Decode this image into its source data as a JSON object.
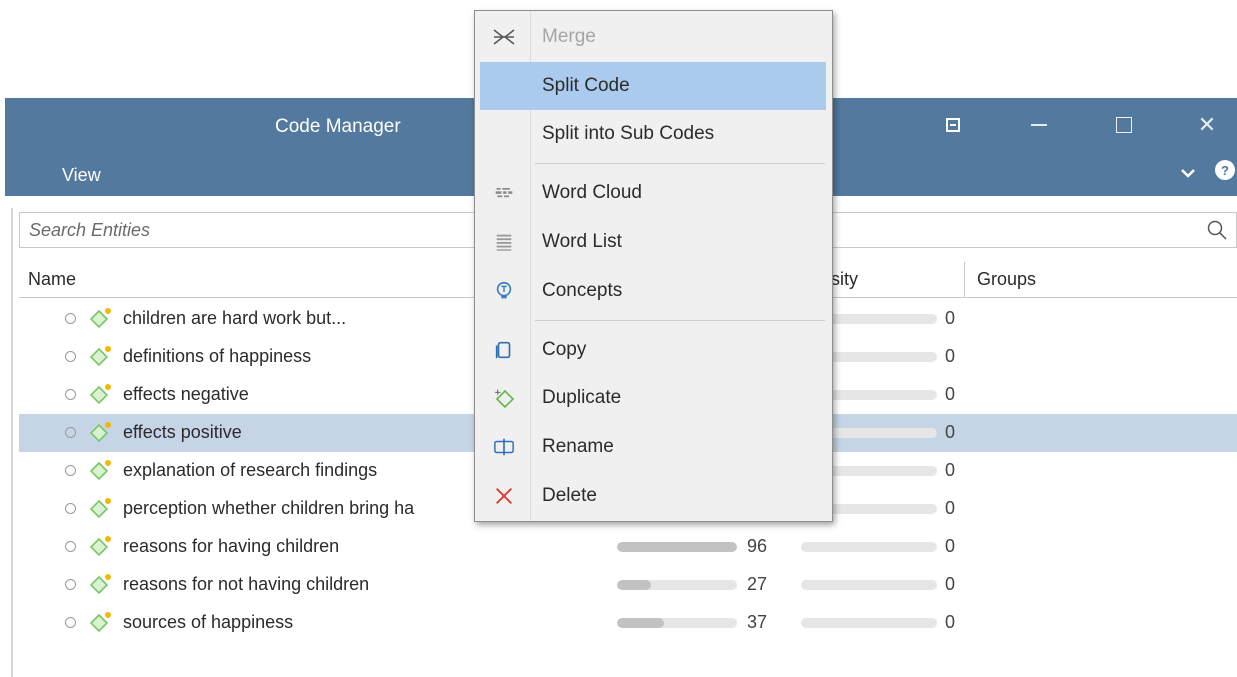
{
  "window": {
    "title": "Code Manager",
    "menu_view": "View",
    "close_glyph": "✕",
    "chevron_glyph": "⌄",
    "help_glyph": "?"
  },
  "search": {
    "placeholder": "Search Entities"
  },
  "columns": {
    "name": "Name",
    "density_partial": "sity",
    "groups": "Groups"
  },
  "codes": [
    {
      "label": "children are hard work but...",
      "count": "",
      "density": "0"
    },
    {
      "label": "definitions of happiness",
      "count": "",
      "density": "0"
    },
    {
      "label": "effects negative",
      "count": "",
      "density": "0"
    },
    {
      "label": "effects positive",
      "count": "",
      "density": "0",
      "selected": true
    },
    {
      "label": "explanation of research findings",
      "count": "",
      "density": "0"
    },
    {
      "label": "perception whether children bring ha",
      "count": "",
      "density": "0"
    },
    {
      "label": "reasons for having children",
      "count": "96",
      "density": "0",
      "fill": 1.0
    },
    {
      "label": "reasons for not having children",
      "count": "27",
      "density": "0",
      "fill": 0.28
    },
    {
      "label": "sources of happiness",
      "count": "37",
      "density": "0",
      "fill": 0.39
    }
  ],
  "context_menu": {
    "items": [
      {
        "label": "Merge",
        "icon": "merge-icon",
        "disabled": true
      },
      {
        "label": "Split Code",
        "icon": "",
        "highlighted": true
      },
      {
        "label": "Split into Sub Codes",
        "icon": ""
      },
      {
        "label": "Word Cloud",
        "icon": "word-cloud-icon"
      },
      {
        "label": "Word List",
        "icon": "word-list-icon"
      },
      {
        "label": "Concepts",
        "icon": "concepts-icon"
      },
      {
        "label": "Copy",
        "icon": "copy-icon"
      },
      {
        "label": "Duplicate",
        "icon": "duplicate-icon"
      },
      {
        "label": "Rename",
        "icon": "rename-icon"
      },
      {
        "label": "Delete",
        "icon": "delete-icon"
      }
    ]
  },
  "colors": {
    "titlebar": "#53799f",
    "selected_row": "#c5d5e6",
    "menu_highlight": "#aacbed",
    "code_icon_green": "#9fd98c",
    "code_icon_dot": "#f5b800",
    "delete_red": "#e0342e"
  }
}
